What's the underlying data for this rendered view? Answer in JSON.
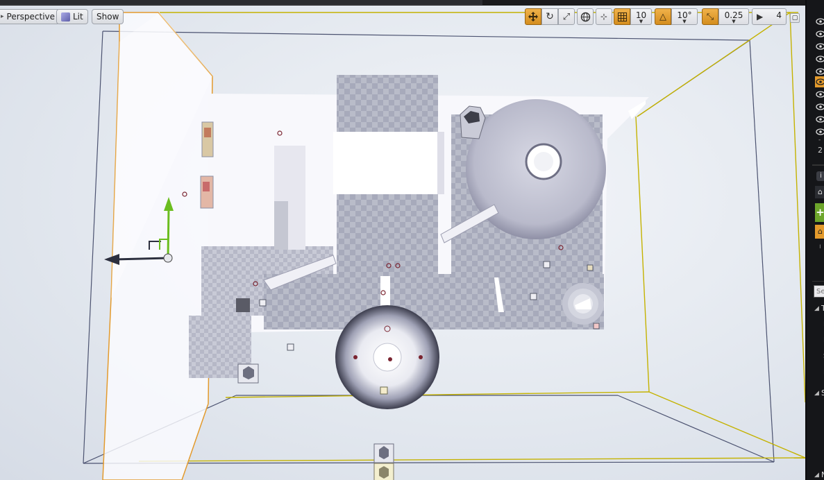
{
  "viewport_toolbar": {
    "perspective_label": "Perspective",
    "lit_label": "Lit",
    "show_label": "Show",
    "grid_snap_value": "10",
    "rotation_snap_value": "10°",
    "scale_snap_value": "0.25",
    "camera_speed_value": "4"
  },
  "right_panel": {
    "partial_count": "2",
    "search_placeholder": "Sea",
    "section_t": "T",
    "section_s": "S",
    "section_n": "N",
    "letters": [
      "L",
      "F",
      "S",
      "N"
    ]
  },
  "colors": {
    "accent_orange": "#e39a2c",
    "selection_yellow": "#c9b400",
    "add_green": "#6da52b",
    "panel_bg": "#151619"
  }
}
